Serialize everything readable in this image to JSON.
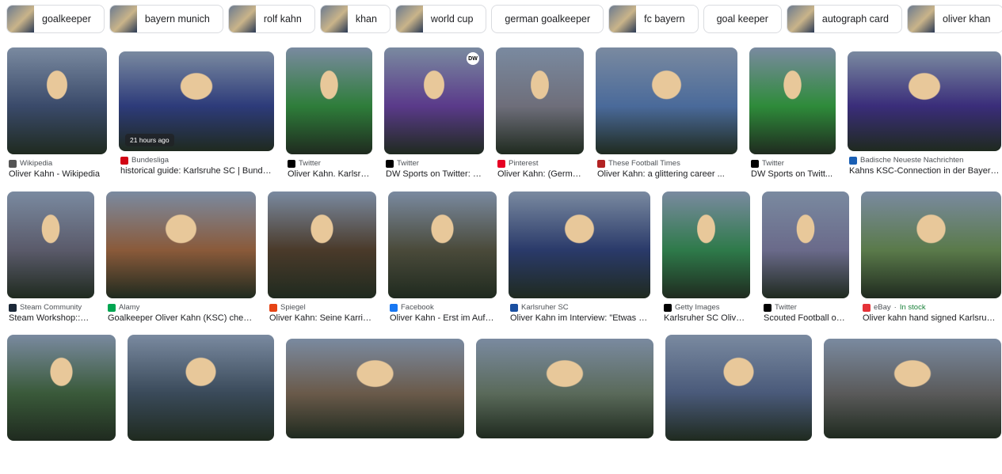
{
  "chips": [
    {
      "label": "goalkeeper",
      "thumb": true
    },
    {
      "label": "bayern munich",
      "thumb": true
    },
    {
      "label": "rolf kahn",
      "thumb": true
    },
    {
      "label": "khan",
      "thumb": true
    },
    {
      "label": "world cup",
      "thumb": true
    },
    {
      "label": "german goalkeeper",
      "thumb": false
    },
    {
      "label": "fc bayern",
      "thumb": true
    },
    {
      "label": "goal keeper",
      "thumb": false
    },
    {
      "label": "autograph card",
      "thumb": true
    },
    {
      "label": "oliver khan",
      "thumb": true
    }
  ],
  "results": [
    {
      "source": "Wikipedia",
      "title": "Oliver Kahn - Wikipedia",
      "color": "#3a4a6a",
      "srcColor": "#555"
    },
    {
      "source": "Bundesliga",
      "title": "historical guide: Karlsruhe SC | Bunde...",
      "color": "#2d3b7a",
      "srcColor": "#d20515",
      "badge": "21 hours ago"
    },
    {
      "source": "Twitter",
      "title": "Oliver Kahn. Karlsruh...",
      "color": "#2e7d3a",
      "srcColor": "#000"
    },
    {
      "source": "Twitter",
      "title": "DW Sports on Twitter: \"...",
      "color": "#5a3a8a",
      "srcColor": "#000",
      "logo": "DW"
    },
    {
      "source": "Pinterest",
      "title": "Oliver Kahn: (Germa...",
      "color": "#6e6e7a",
      "srcColor": "#e60023"
    },
    {
      "source": "These Football Times",
      "title": "Oliver Kahn: a glittering career ...",
      "color": "#4a6a9a",
      "srcColor": "#b22222"
    },
    {
      "source": "Twitter",
      "title": "DW Sports on Twitt...",
      "color": "#2e8b3a",
      "srcColor": "#000"
    },
    {
      "source": "Badische Neueste Nachrichten",
      "title": "Kahns KSC-Connection in der Bayern-...",
      "color": "#3a2d7a",
      "srcColor": "#1a5fb4"
    },
    {
      "source": "Steam Community",
      "title": "Steam Workshop::O...",
      "color": "#5a5a6a",
      "srcColor": "#1b2838"
    },
    {
      "source": "Alamy",
      "title": "Goalkeeper Oliver Kahn (KSC) cheer...",
      "color": "#8a5a3a",
      "srcColor": "#00a651"
    },
    {
      "source": "Spiegel",
      "title": "Oliver Kahn: Seine Karrier...",
      "color": "#4a3a2a",
      "srcColor": "#e64415"
    },
    {
      "source": "Facebook",
      "title": "Oliver Kahn - Erst im Aufg...",
      "color": "#4a4a3a",
      "srcColor": "#1877f2"
    },
    {
      "source": "Karlsruher SC",
      "title": "Oliver Kahn im Interview: \"Etwas g...",
      "color": "#2a3a6a",
      "srcColor": "#1a4fa0"
    },
    {
      "source": "Getty Images",
      "title": "Karlsruher SC Oliver...",
      "color": "#2e7a4a",
      "srcColor": "#000"
    },
    {
      "source": "Twitter",
      "title": "Scouted Football on...",
      "color": "#6a6a8a",
      "srcColor": "#000"
    },
    {
      "source": "eBay",
      "stock": "In stock",
      "title": "Oliver kahn hand signed Karlsruhe...",
      "color": "#5a7a4a",
      "srcColor": "#e53238"
    },
    {
      "source": "",
      "title": "",
      "color": "#3a5a3a"
    },
    {
      "source": "",
      "title": "",
      "color": "#3a4a5a"
    },
    {
      "source": "",
      "title": "",
      "color": "#6a5a4a"
    },
    {
      "source": "",
      "title": "",
      "color": "#5a6a5a"
    },
    {
      "source": "",
      "title": "",
      "color": "#4a5a7a"
    },
    {
      "source": "",
      "title": "",
      "color": "#5a5a5a"
    }
  ]
}
